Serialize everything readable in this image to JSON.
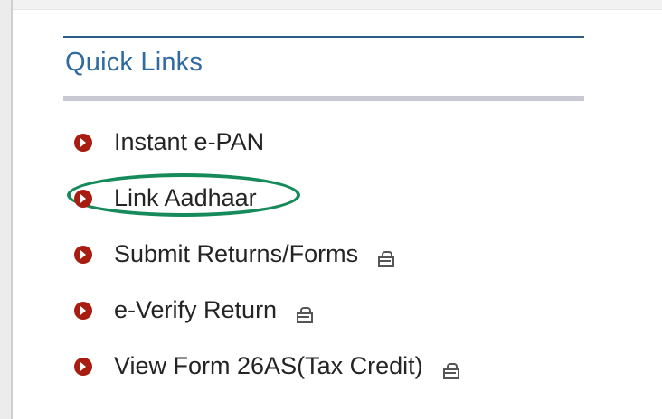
{
  "quick_links": {
    "title": "Quick Links",
    "items": [
      {
        "label": "Instant e-PAN",
        "locked": false,
        "highlighted": false
      },
      {
        "label": "Link Aadhaar",
        "locked": false,
        "highlighted": true
      },
      {
        "label": "Submit Returns/Forms",
        "locked": true,
        "highlighted": false
      },
      {
        "label": "e-Verify Return",
        "locked": true,
        "highlighted": false
      },
      {
        "label": "View Form 26AS(Tax Credit)",
        "locked": true,
        "highlighted": false
      }
    ]
  },
  "colors": {
    "title": "#2f6aa1",
    "bullet": "#a81d12",
    "highlight": "#168a5a",
    "text": "#242424"
  },
  "icons": {
    "bullet": "play-circle-icon",
    "lock": "lock-icon"
  }
}
